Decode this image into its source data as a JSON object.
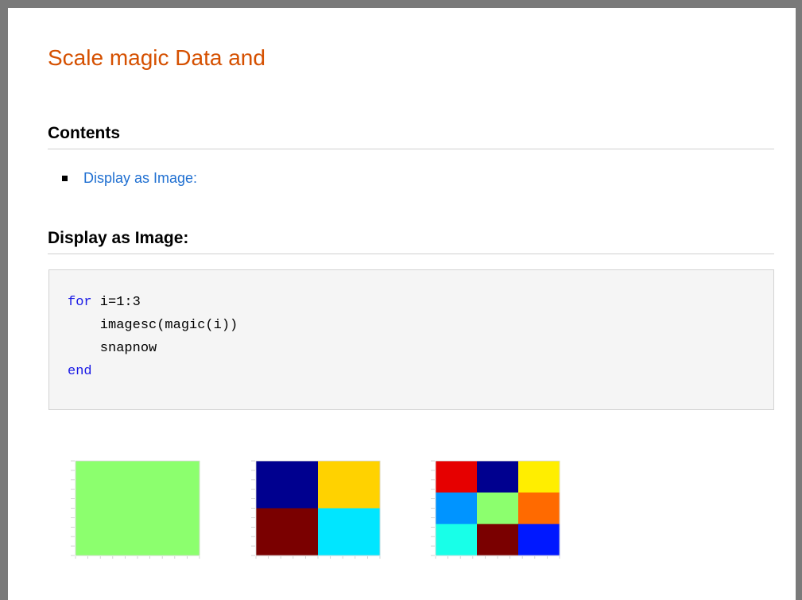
{
  "page": {
    "title": "Scale magic Data and"
  },
  "contents": {
    "heading": "Contents",
    "items": [
      {
        "label": "Display as Image:"
      }
    ]
  },
  "section": {
    "heading": "Display as Image:"
  },
  "code": {
    "lines": [
      {
        "keyword": "for",
        "text": " i=1:3"
      },
      {
        "keyword": "",
        "text": "    imagesc(magic(i))"
      },
      {
        "keyword": "",
        "text": "    snapnow"
      },
      {
        "keyword": "end",
        "text": ""
      }
    ]
  },
  "images": [
    {
      "grid": [
        [
          "#8cff6e"
        ]
      ]
    },
    {
      "grid": [
        [
          "#00008f",
          "#ffd200"
        ],
        [
          "#7a0000",
          "#00e6ff"
        ]
      ]
    },
    {
      "grid": [
        [
          "#e60000",
          "#00008f",
          "#ffee00"
        ],
        [
          "#0094ff",
          "#8cff6e",
          "#ff6a00"
        ],
        [
          "#18ffe8",
          "#7a0000",
          "#0018ff"
        ]
      ]
    }
  ]
}
